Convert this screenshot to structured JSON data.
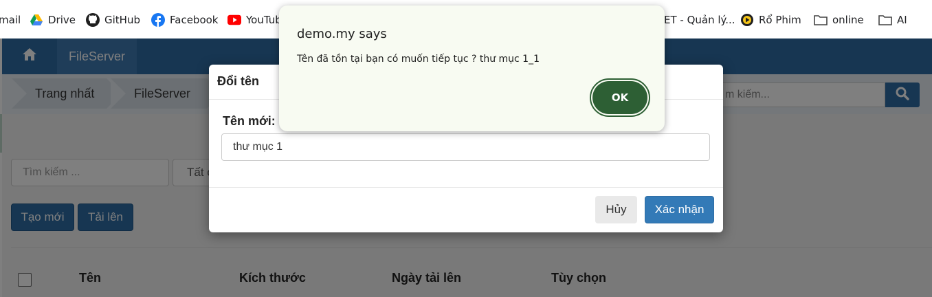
{
  "bookmarks": [
    {
      "label": "mail",
      "icon": "gmail-icon"
    },
    {
      "label": "Drive",
      "icon": "drive-icon"
    },
    {
      "label": "GitHub",
      "icon": "github-icon"
    },
    {
      "label": "Facebook",
      "icon": "facebook-icon"
    },
    {
      "label": "YouTub",
      "icon": "youtube-icon"
    },
    {
      "label": "ET - Quản lý...",
      "icon": ""
    },
    {
      "label": "Rổ Phim",
      "icon": "play-icon"
    },
    {
      "label": "online",
      "icon": "folder-icon"
    },
    {
      "label": "AI",
      "icon": "folder-icon"
    }
  ],
  "navbar": {
    "brand": "FileServer",
    "home_icon": "home-icon",
    "color": "#2e6da4"
  },
  "breadcrumb": [
    "Trang nhất",
    "FileServer"
  ],
  "top_search": {
    "placeholder": "m kiếm...",
    "icon": "search-icon"
  },
  "filter": {
    "search_placeholder": "Tìm kiếm ...",
    "select_value": "Tất c"
  },
  "actions": {
    "create": "Tạo mới",
    "upload": "Tải lên"
  },
  "table": {
    "headers": [
      "Tên",
      "Kích thước",
      "Ngày tải lên",
      "Tùy chọn"
    ]
  },
  "modal": {
    "title": "Đổi tên",
    "label": "Tên mới:",
    "value": "thư mục 1",
    "cancel": "Hủy",
    "confirm": "Xác nhận"
  },
  "alert": {
    "title": "demo.my says",
    "message": "Tên đã tồn tại bạn có muốn tiếp tục ? thư mục 1_1",
    "ok": "OK",
    "accent": "#2d5f34"
  }
}
